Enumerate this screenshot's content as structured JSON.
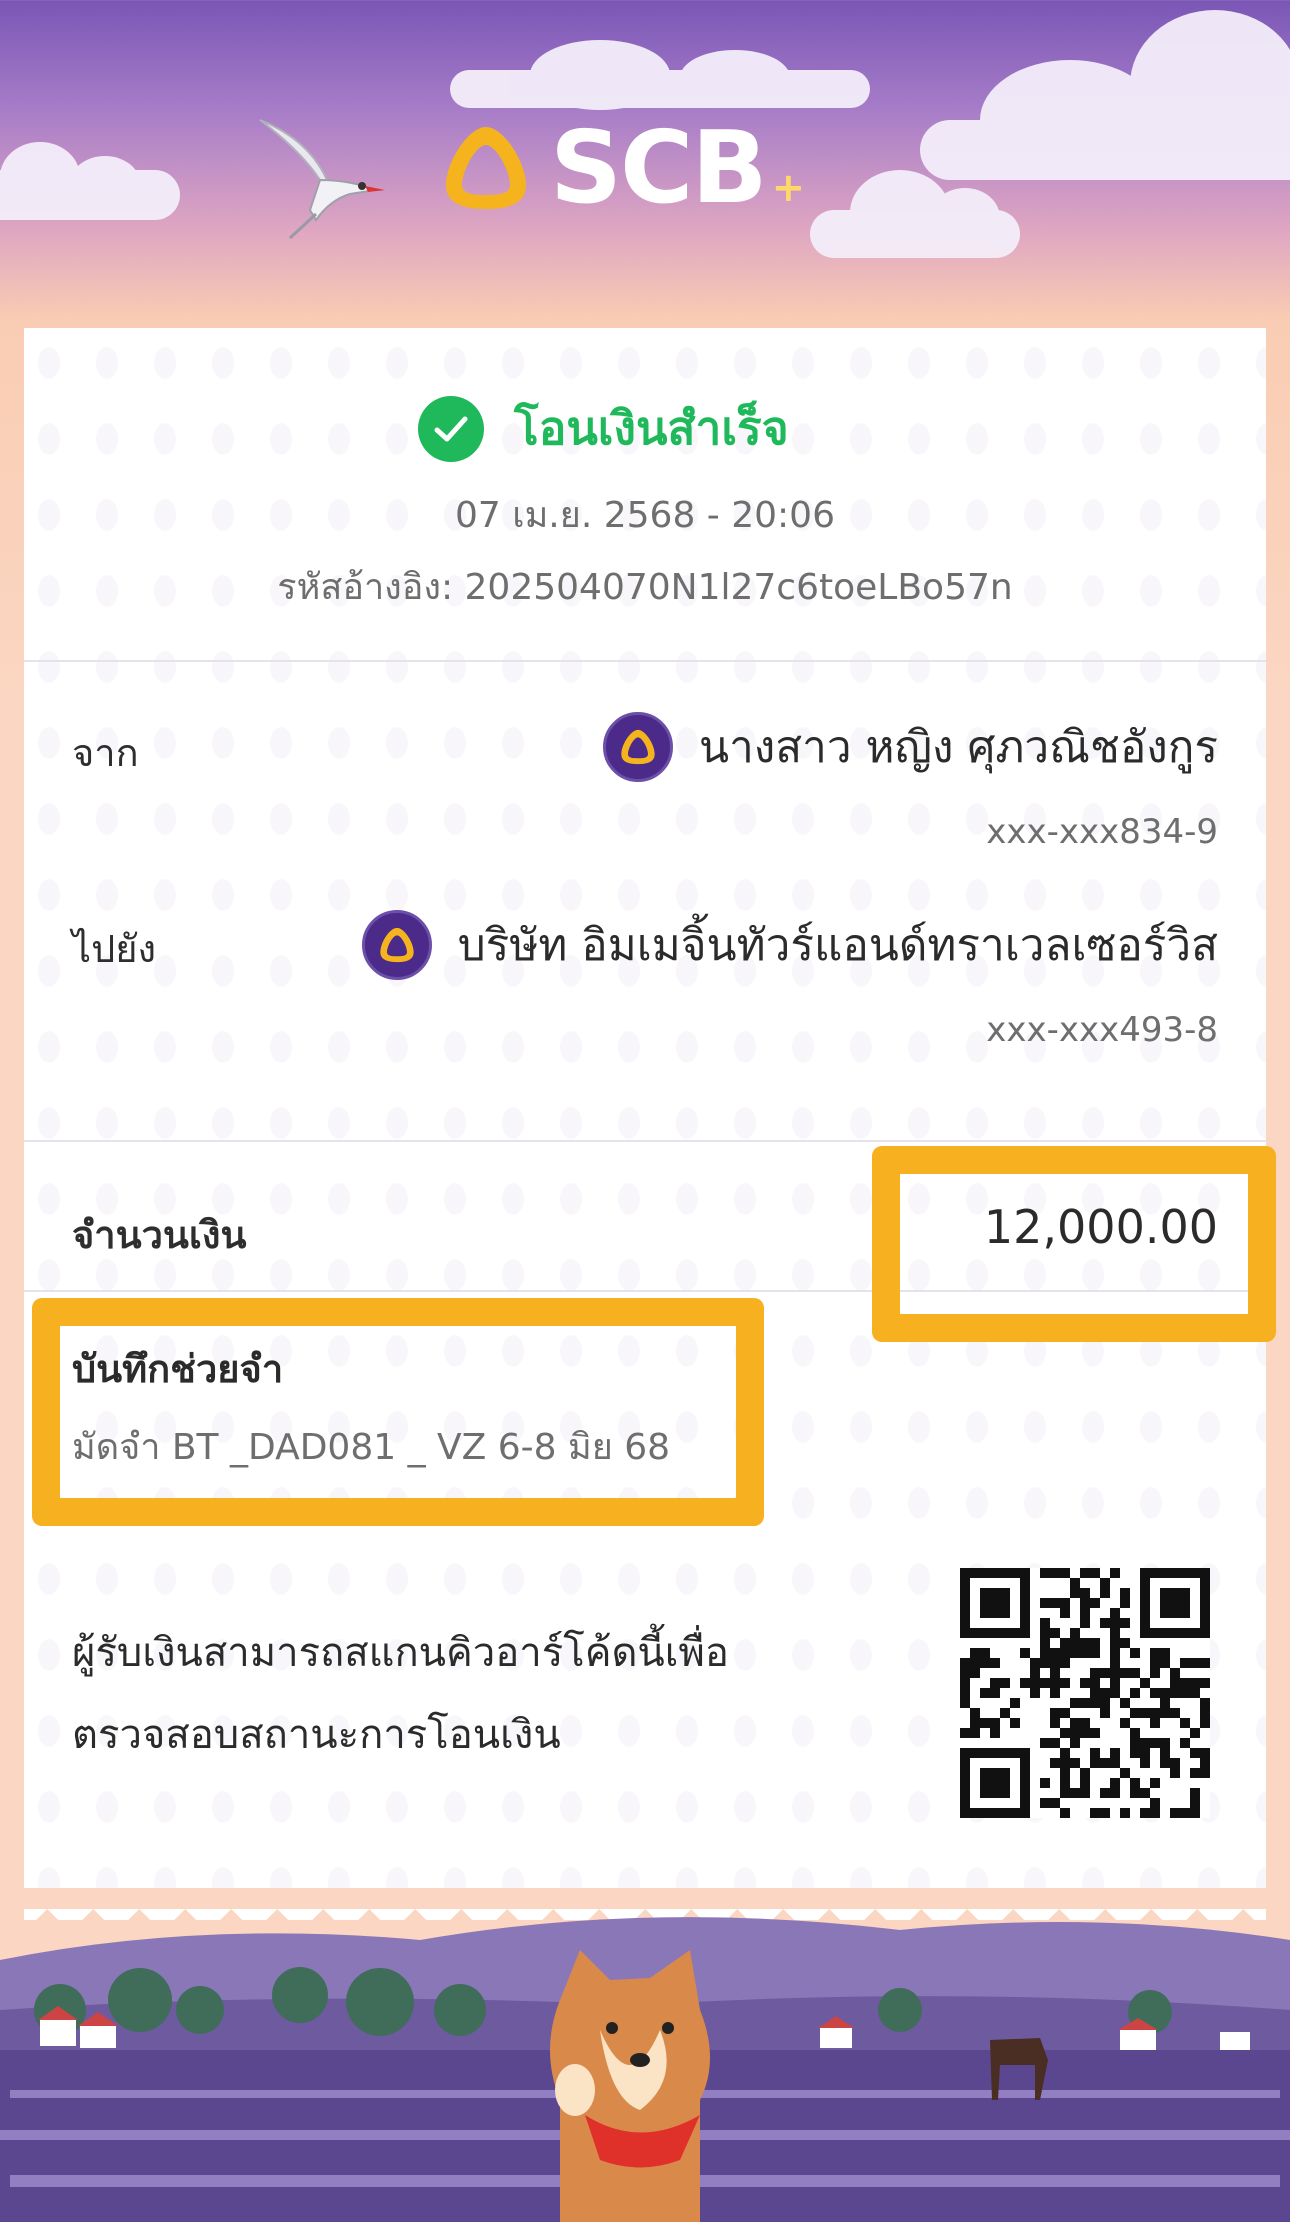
{
  "brand": {
    "name": "SCB",
    "plus": "+"
  },
  "transfer": {
    "status": "โอนเงินสำเร็จ",
    "datetime": "07 เม.ย. 2568 - 20:06",
    "reference": "รหัสอ้างอิง: 202504070N1l27c6toeLBo57n"
  },
  "from": {
    "label": "จาก",
    "name": "นางสาว หญิง ศุภวณิชอังกูร",
    "account": "xxx-xxx834-9"
  },
  "to": {
    "label": "ไปยัง",
    "name": "บริษัท อิมเมจิ้นทัวร์แอนด์ทราเวลเซอร์วิส",
    "account": "xxx-xxx493-8"
  },
  "amount": {
    "label": "จำนวนเงิน",
    "value": "12,000.00"
  },
  "memo": {
    "label": "บันทึกช่วยจำ",
    "value": "มัดจำ BT _DAD081 _ VZ 6-8 มิย 68"
  },
  "qr": {
    "text_line1": "ผู้รับเงินสามารถสแกนคิวอาร์โค้ดนี้เพื่อ",
    "text_line2": "ตรวจสอบสถานะการโอนเงิน"
  },
  "colors": {
    "success": "#1fb85a",
    "highlight": "#f7b020",
    "brand_purple": "#4b2a8a",
    "brand_gold": "#f5b41e"
  },
  "icons": [
    "check-circle-icon",
    "scb-logo-icon",
    "bank-logo-icon",
    "qr-code"
  ]
}
